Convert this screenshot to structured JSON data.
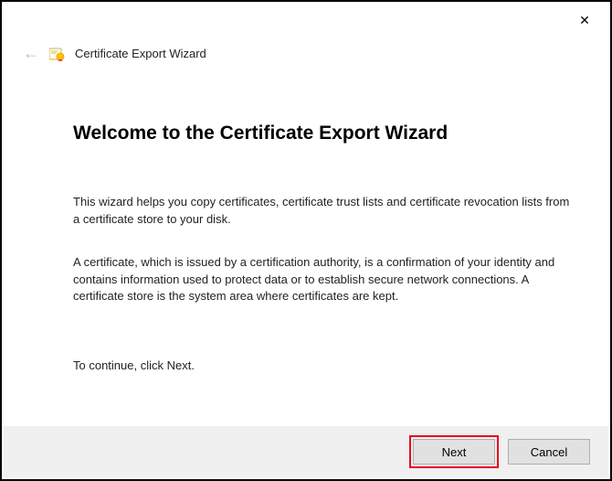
{
  "titlebar": {
    "close_glyph": "✕"
  },
  "header": {
    "back_glyph": "←",
    "wizard_title": "Certificate Export Wizard"
  },
  "main": {
    "heading": "Welcome to the Certificate Export Wizard",
    "intro": "This wizard helps you copy certificates, certificate trust lists and certificate revocation lists from a certificate store to your disk.",
    "explain": "A certificate, which is issued by a certification authority, is a confirmation of your identity and contains information used to protect data or to establish secure network connections. A certificate store is the system area where certificates are kept.",
    "continue_line": "To continue, click Next."
  },
  "footer": {
    "next_label": "Next",
    "cancel_label": "Cancel"
  }
}
